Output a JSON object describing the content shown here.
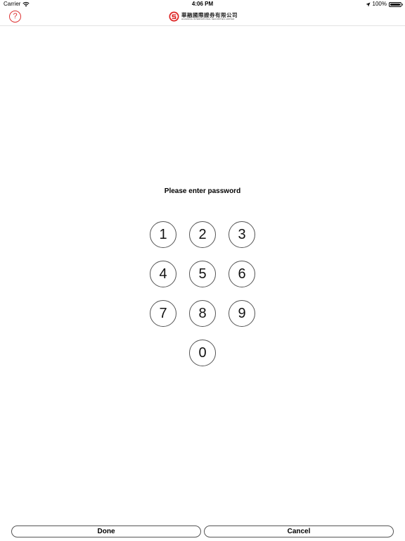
{
  "status_bar": {
    "carrier": "Carrier",
    "time": "4:06 PM",
    "battery": "100%",
    "battery_level": 1.0,
    "icons": [
      "wifi-icon",
      "location-arrow-icon",
      "battery-icon"
    ]
  },
  "header": {
    "help_label": "?",
    "logo_cn": "華融國際證券有限公司",
    "logo_en": "HUARONG INTERNATIONAL SECURITIES LIMITED",
    "accent_color": "#dd3333"
  },
  "prompt": "Please enter password",
  "keypad": {
    "k1": "1",
    "k2": "2",
    "k3": "3",
    "k4": "4",
    "k5": "5",
    "k6": "6",
    "k7": "7",
    "k8": "8",
    "k9": "9",
    "k0": "0"
  },
  "actions": {
    "done": "Done",
    "cancel": "Cancel"
  }
}
